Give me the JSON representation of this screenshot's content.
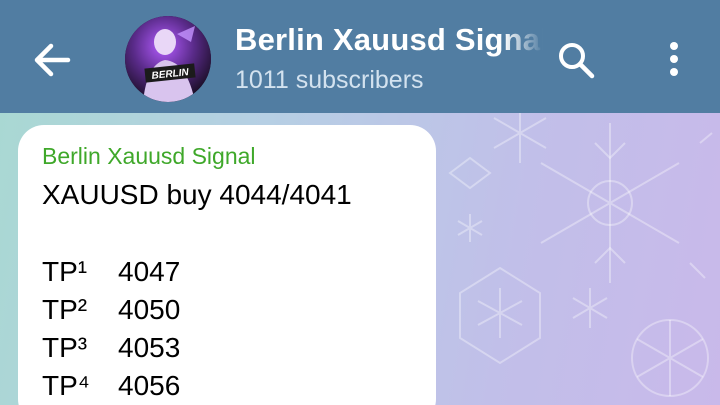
{
  "header": {
    "title": "Berlin Xauusd Signal",
    "subtitle": "1011 subscribers",
    "avatar_text": "BERLIN",
    "back_icon": "arrow-left-icon",
    "search_icon": "search-icon",
    "menu_icon": "more-vertical-icon"
  },
  "message": {
    "sender": "Berlin Xauusd Signal",
    "line1": "XAUUSD buy 4044/4041",
    "tps": [
      {
        "label": "TP¹",
        "value": "4047"
      },
      {
        "label": "TP²",
        "value": "4050"
      },
      {
        "label": "TP³",
        "value": "4053"
      },
      {
        "label": "TP⁴",
        "value": "4056"
      }
    ]
  },
  "colors": {
    "header": "#517da2",
    "sender_name": "#3fa82a",
    "bubble": "#ffffff"
  }
}
